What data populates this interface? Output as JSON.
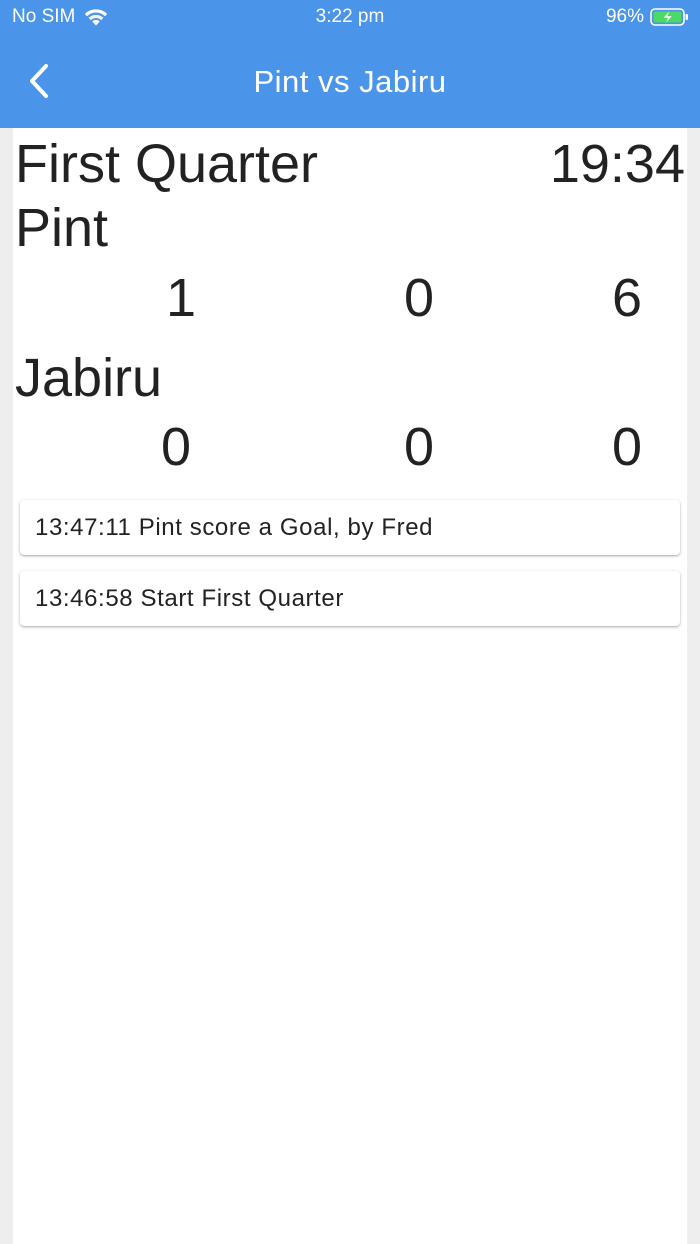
{
  "status_bar": {
    "carrier": "No SIM",
    "time": "3:22 pm",
    "battery": "96%"
  },
  "navbar": {
    "title": "Pint vs Jabiru"
  },
  "game": {
    "quarter": "First Quarter",
    "clock": "19:34",
    "teams": [
      {
        "name": "Pint",
        "goals": "1",
        "behinds": "0",
        "total": "6"
      },
      {
        "name": "Jabiru",
        "goals": "0",
        "behinds": "0",
        "total": "0"
      }
    ]
  },
  "log": [
    {
      "text": "13:47:11 Pint score a Goal, by Fred"
    },
    {
      "text": "13:46:58 Start First Quarter"
    }
  ],
  "colors": {
    "header": "#4a94ea",
    "battery_fill": "#4cd964"
  }
}
